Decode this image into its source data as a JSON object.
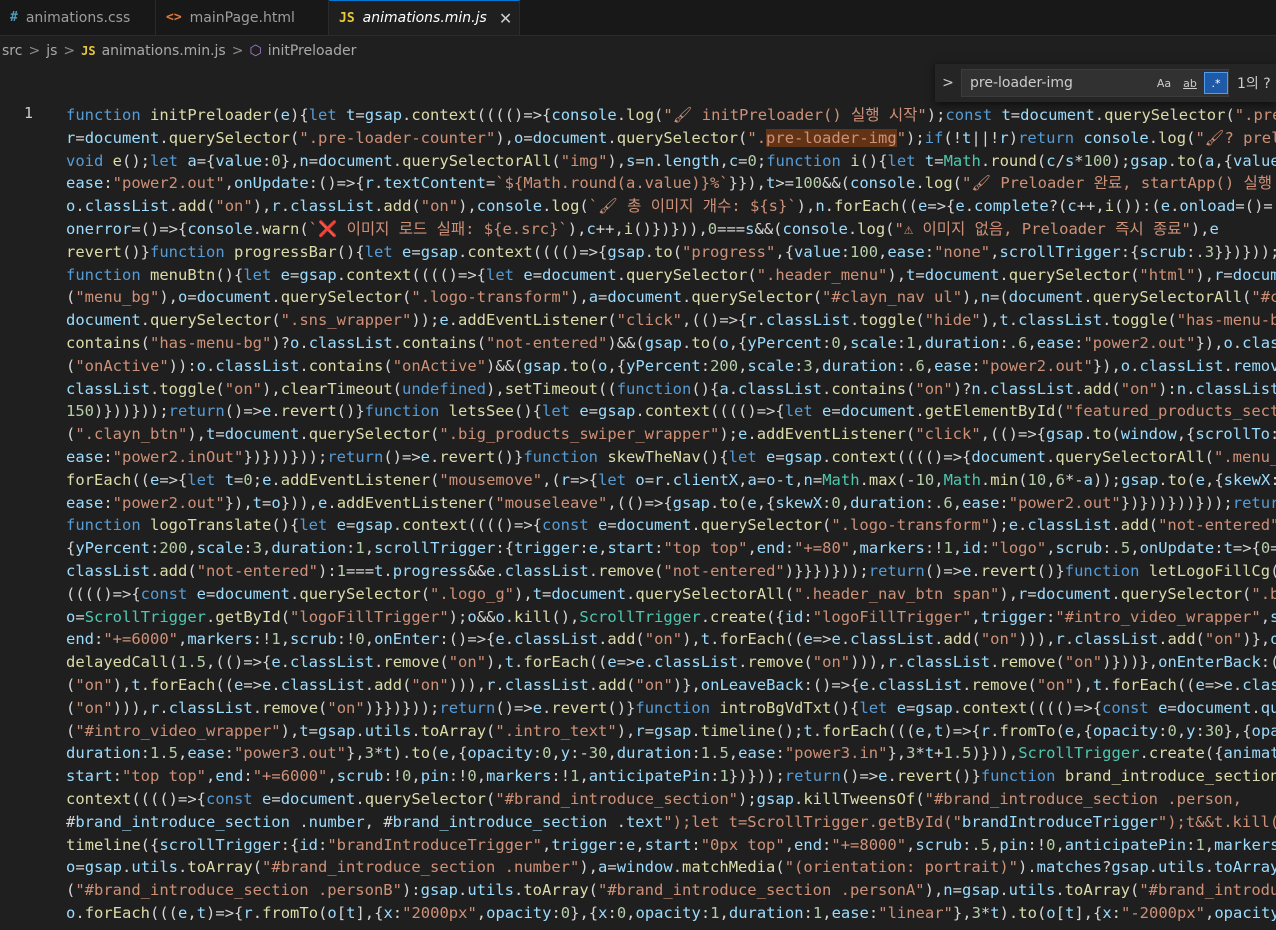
{
  "tabs": [
    {
      "icon": "#",
      "label": "animations.css"
    },
    {
      "icon": "<>",
      "label": "mainPage.html"
    },
    {
      "icon": "JS",
      "label": "animations.min.js",
      "close": "✕"
    }
  ],
  "breadcrumb": {
    "parts": [
      "src",
      "js"
    ],
    "file_badge": "JS",
    "file": "animations.min.js",
    "symbol": "initPreloader",
    "separator": ">"
  },
  "find": {
    "toggle": ">",
    "value": "pre-loader-img",
    "opt_case": "Aa",
    "opt_word": "ab",
    "opt_regex": ".*",
    "result": "1의 ?"
  },
  "editor": {
    "line_number": "1",
    "lines": [
      "function initPreloader(e){let t=gsap.context(((()=>{console.log(\"🖌 initPreloader() 실행 시작\");const t=document.querySelector(\".pre-",
      "r=document.querySelector(\".pre-loader-counter\"),o=document.querySelector(\".pre-loader-img\");if(!t||!r)return console.log(\"🖌? preloa",
      "void e();let a={value:0},n=document.querySelectorAll(\"img\"),s=n.length,c=0;function i(){let t=Math.round(c/s*100);gsap.to(a,{value:",
      "ease:\"power2.out\",onUpdate:()=>{r.textContent=`${Math.round(a.value)}%`}}),t>=100&&(console.log(\"🖌 Preloader 완료, startApp() 실행",
      "o.classList.add(\"on\"),r.classList.add(\"on\"),console.log(`🖌 총 이미지 개수: ${s}`),n.forEach((e=>{e.complete?(c++,i()):(e.onload=()=",
      "onerror=()=>{console.warn(`❌ 이미지 로드 실패: ${e.src}`),c++,i()})})),0===s&&(console.log(\"⚠ 이미지 없음, Preloader 즉시 종료\"),e",
      "revert()}function progressBar(){let e=gsap.context(((()=>{gsap.to(\"progress\",{value:100,ease:\"none\",scrollTrigger:{scrub:.3}})}));re",
      "function menuBtn(){let e=gsap.context(((()=>{let e=document.querySelector(\".header_menu\"),t=document.querySelector(\"html\"),r=documen",
      "(\"menu_bg\"),o=document.querySelector(\".logo-transform\"),a=document.querySelector(\"#clayn_nav ul\"),n=(document.querySelectorAll(\"#cl",
      "document.querySelector(\".sns_wrapper\"));e.addEventListener(\"click\",(()=>{r.classList.toggle(\"hide\"),t.classList.toggle(\"has-menu-bg",
      "contains(\"has-menu-bg\")?o.classList.contains(\"not-entered\")&&(gsap.to(o,{yPercent:0,scale:1,duration:.6,ease:\"power2.out\"}),o.class",
      "(\"onActive\")):o.classList.contains(\"onActive\")&&(gsap.to(o,{yPercent:200,scale:3,duration:.6,ease:\"power2.out\"}),o.classList.remove",
      "classList.toggle(\"on\"),clearTimeout(undefined),setTimeout((function(){a.classList.contains(\"on\")?n.classList.add(\"on\"):n.classList.",
      "150)}))}));return()=>e.revert()}function letsSee(){let e=gsap.context(((()=>{let e=document.getElementById(\"featured_products_sectio",
      "(\".clayn_btn\"),t=document.querySelector(\".big_products_swiper_wrapper\");e.addEventListener(\"click\",(()=>{gsap.to(window,{scrollTo:t",
      "ease:\"power2.inOut\"})}))}));return()=>e.revert()}function skewTheNav(){let e=gsap.context(((()=>{document.querySelectorAll(\".menu_bg",
      "forEach((e=>{let t=0;e.addEventListener(\"mousemove\",(r=>{let o=r.clientX,a=o-t,n=Math.max(-10,Math.min(10,6*-a));gsap.to(e,{skewX:n",
      "ease:\"power2.out\"}),t=o})),e.addEventListener(\"mouseleave\",(()=>{gsap.to(e,{skewX:0,duration:.6,ease:\"power2.out\"})}))}))}));return",
      "function logoTranslate(){let e=gsap.context(((()=>{const e=document.querySelector(\".logo-transform\");e.classList.add(\"not-entered\"),",
      "{yPercent:200,scale:3,duration:1,scrollTrigger:{trigger:e,start:\"top top\",end:\"+=80\",markers:!1,id:\"logo\",scrub:.5,onUpdate:t=>{0==",
      "classList.add(\"not-entered\"):1===t.progress&&e.classList.remove(\"not-entered\")}}})}));return()=>e.revert()}function letLogoFillCg()",
      "(((()=>{const e=document.querySelector(\".logo_g\"),t=document.querySelectorAll(\".header_nav_btn span\"),r=document.querySelector(\".buc",
      "o=ScrollTrigger.getById(\"logoFillTrigger\");o&&o.kill(),ScrollTrigger.create({id:\"logoFillTrigger\",trigger:\"#intro_video_wrapper\",st",
      "end:\"+=6000\",markers:!1,scrub:!0,onEnter:()=>{e.classList.add(\"on\"),t.forEach((e=>e.classList.add(\"on\"))),r.classList.add(\"on\")},on",
      "delayedCall(1.5,(()=>{e.classList.remove(\"on\"),t.forEach((e=>e.classList.remove(\"on\"))),r.classList.remove(\"on\")}))},onEnterBack:()",
      "(\"on\"),t.forEach((e=>e.classList.add(\"on\"))),r.classList.add(\"on\")},onLeaveBack:()=>{e.classList.remove(\"on\"),t.forEach((e=>e.class",
      "(\"on\"))),r.classList.remove(\"on\")}})}));return()=>e.revert()}function introBgVdTxt(){let e=gsap.context(((()=>{const e=document.quer",
      "(\"#intro_video_wrapper\"),t=gsap.utils.toArray(\".intro_text\"),r=gsap.timeline();t.forEach(((e,t)=>{r.fromTo(e,{opacity:0,y:30},{opac",
      "duration:1.5,ease:\"power3.out\"},3*t).to(e,{opacity:0,y:-30,duration:1.5,ease:\"power3.in\"},3*t+1.5)})),ScrollTrigger.create({animati",
      "start:\"top top\",end:\"+=6000\",scrub:!0,pin:!0,markers:!1,anticipatePin:1})}));return()=>e.revert()}function brand_introduce_section(",
      "context(((()=>{const e=document.querySelector(\"#brand_introduce_section\");gsap.killTweensOf(\"#brand_introduce_section .person,",
      "#brand_introduce_section .number, #brand_introduce_section .text\");let t=ScrollTrigger.getById(\"brandIntroduceTrigger\");t&&t.kill()",
      "timeline({scrollTrigger:{id:\"brandIntroduceTrigger\",trigger:e,start:\"0px top\",end:\"+=8000\",scrub:.5,pin:!0,anticipatePin:1,markers:",
      "o=gsap.utils.toArray(\"#brand_introduce_section .number\"),a=window.matchMedia(\"(orientation: portrait)\").matches?gsap.utils.toArray",
      "(\"#brand_introduce_section .personB\"):gsap.utils.toArray(\"#brand_introduce_section .personA\"),n=gsap.utils.toArray(\"#brand_introduc",
      "o.forEach(((e,t)=>{r.fromTo(o[t],{x:\"2000px\",opacity:0},{x:0,opacity:1,duration:1,ease:\"linear\"},3*t).to(o[t],{x:\"-2000px\",opacity:"
    ]
  }
}
